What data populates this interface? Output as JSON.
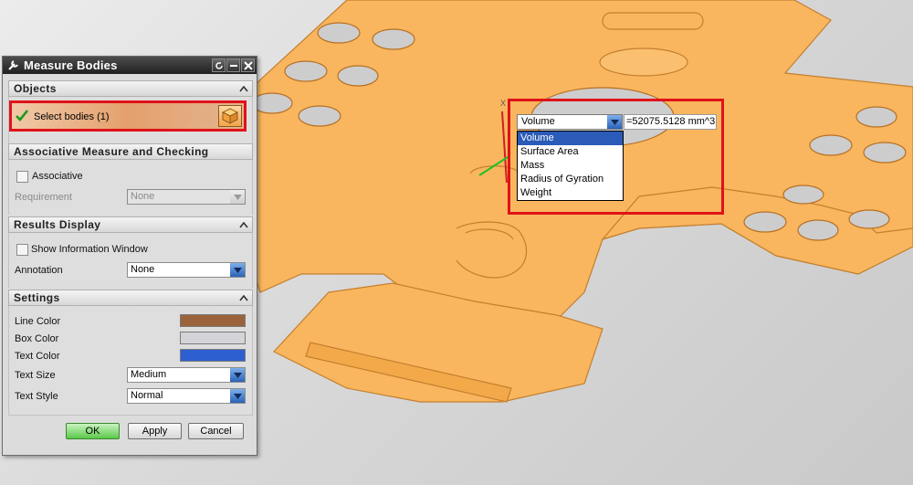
{
  "dialog": {
    "title": "Measure Bodies",
    "sections": {
      "objects": {
        "title": "Objects",
        "select_label": "Select bodies (1)"
      },
      "associative": {
        "title": "Associative Measure and Checking",
        "associative_label": "Associative",
        "requirement_label": "Requirement",
        "requirement_value": "None"
      },
      "results": {
        "title": "Results Display",
        "show_info_label": "Show Information Window",
        "annotation_label": "Annotation",
        "annotation_value": "None"
      },
      "settings": {
        "title": "Settings",
        "line_color_label": "Line Color",
        "line_color": "#9b633a",
        "box_color_label": "Box Color",
        "box_color": "#d4d4d8",
        "text_color_label": "Text Color",
        "text_color": "#2d5fd0",
        "text_size_label": "Text Size",
        "text_size_value": "Medium",
        "text_style_label": "Text Style",
        "text_style_value": "Normal"
      }
    },
    "buttons": {
      "ok": "OK",
      "apply": "Apply",
      "cancel": "Cancel"
    }
  },
  "measurement": {
    "selected": "Volume",
    "value": "=52075.5128 mm^3",
    "options": [
      "Volume",
      "Surface Area",
      "Mass",
      "Radius of Gyration",
      "Weight"
    ]
  },
  "colors": {
    "part": "#f9b65e",
    "part_edge": "#c47f2e",
    "highlight": "#e0121a"
  }
}
